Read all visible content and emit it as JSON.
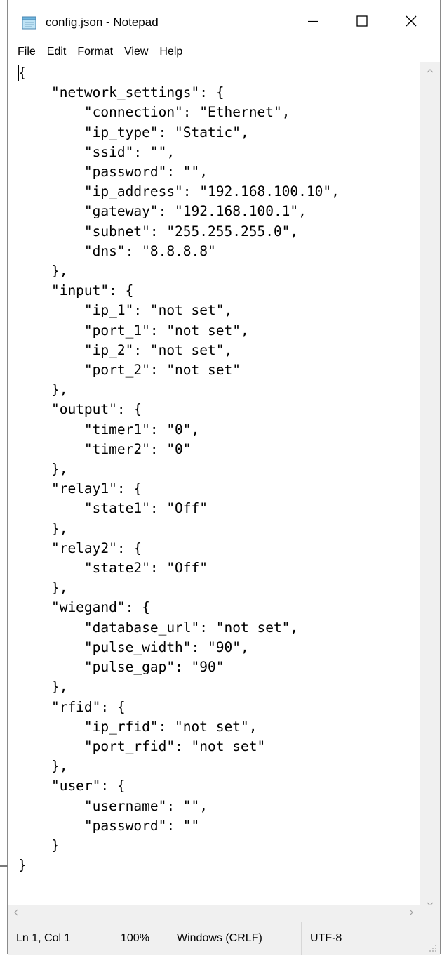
{
  "window": {
    "title": "config.json - Notepad",
    "icon": "notepad-icon",
    "controls": [
      "minimize-icon",
      "maximize-icon",
      "close-icon"
    ]
  },
  "menu": {
    "file": "File",
    "edit": "Edit",
    "format": "Format",
    "view": "View",
    "help": "Help"
  },
  "editor": {
    "content": "{\n    \"network_settings\": {\n        \"connection\": \"Ethernet\",\n        \"ip_type\": \"Static\",\n        \"ssid\": \"\",\n        \"password\": \"\",\n        \"ip_address\": \"192.168.100.10\",\n        \"gateway\": \"192.168.100.1\",\n        \"subnet\": \"255.255.255.0\",\n        \"dns\": \"8.8.8.8\"\n    },\n    \"input\": {\n        \"ip_1\": \"not set\",\n        \"port_1\": \"not set\",\n        \"ip_2\": \"not set\",\n        \"port_2\": \"not set\"\n    },\n    \"output\": {\n        \"timer1\": \"0\",\n        \"timer2\": \"0\"\n    },\n    \"relay1\": {\n        \"state1\": \"Off\"\n    },\n    \"relay2\": {\n        \"state2\": \"Off\"\n    },\n    \"wiegand\": {\n        \"database_url\": \"not set\",\n        \"pulse_width\": \"90\",\n        \"pulse_gap\": \"90\"\n    },\n    \"rfid\": {\n        \"ip_rfid\": \"not set\",\n        \"port_rfid\": \"not set\"\n    },\n    \"user\": {\n        \"username\": \"\",\n        \"password\": \"\"\n    }\n}"
  },
  "status": {
    "position": "Ln 1, Col 1",
    "zoom": "100%",
    "line_endings": "Windows (CRLF)",
    "encoding": "UTF-8"
  }
}
